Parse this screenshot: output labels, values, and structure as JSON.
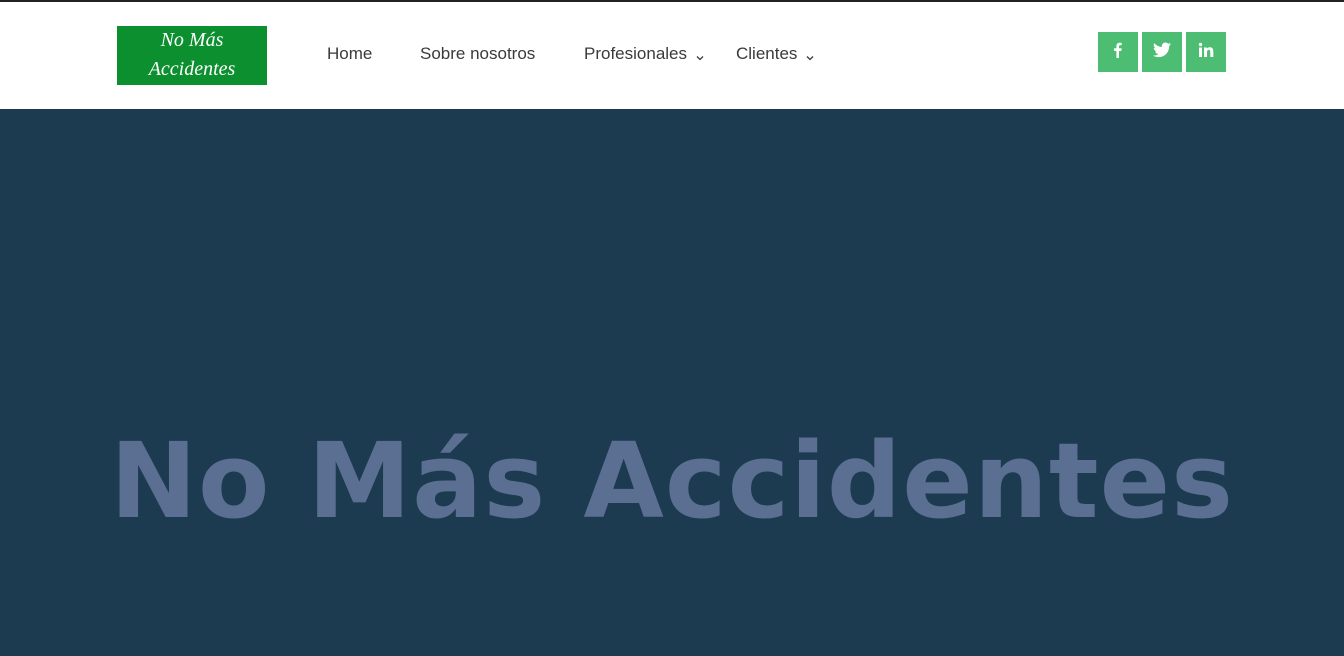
{
  "logo": {
    "line1": "No Más",
    "line2": "Accidentes",
    "background": "#0c8f2f"
  },
  "nav": {
    "items": [
      {
        "label": "Home",
        "dropdown": false
      },
      {
        "label": "Sobre nosotros",
        "dropdown": false
      },
      {
        "label": "Profesionales",
        "dropdown": true
      },
      {
        "label": "Clientes",
        "dropdown": true
      }
    ]
  },
  "social": {
    "color": "#4dbd74",
    "items": [
      {
        "icon": "facebook-icon",
        "glyph": "f"
      },
      {
        "icon": "twitter-icon",
        "glyph": ""
      },
      {
        "icon": "linkedin-icon",
        "glyph": "in"
      }
    ]
  },
  "hero": {
    "title": "No Más Accidentes",
    "background": "#1c3a50",
    "title_color": "#5a6f91"
  }
}
